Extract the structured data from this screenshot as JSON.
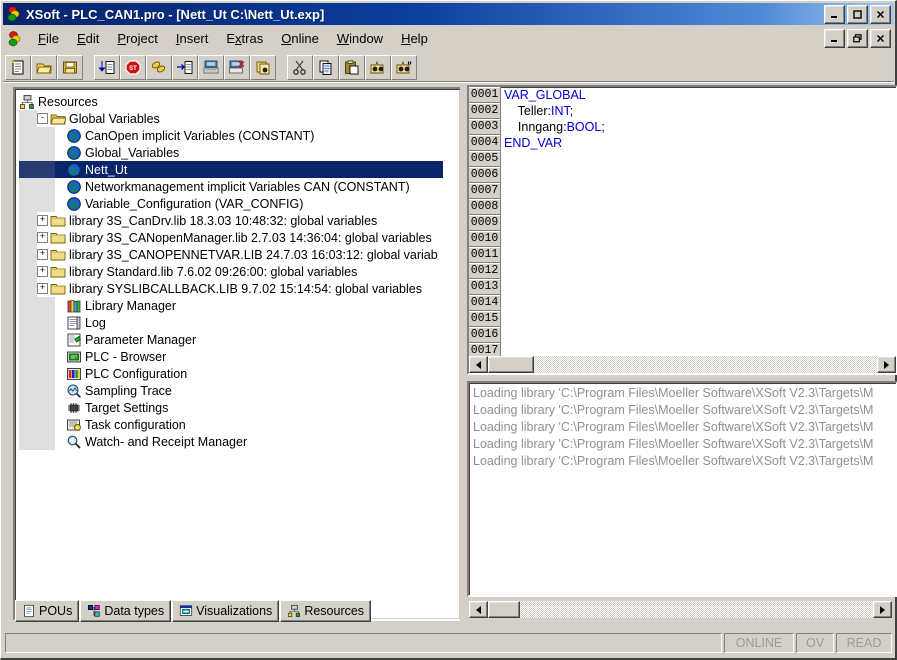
{
  "window": {
    "title": "XSoft - PLC_CAN1.pro - [Nett_Ut C:\\Nett_Ut.exp]",
    "app_icon": "traffic-light-icon",
    "minimize": "_",
    "maximize": "☐",
    "close": "✕",
    "mdi_minimize": "_",
    "mdi_restore": "❐",
    "mdi_close": "✕"
  },
  "menu": {
    "items": [
      {
        "label": "File",
        "accel": "F"
      },
      {
        "label": "Edit",
        "accel": "E"
      },
      {
        "label": "Project",
        "accel": "P"
      },
      {
        "label": "Insert",
        "accel": "I"
      },
      {
        "label": "Extras",
        "accel": "x"
      },
      {
        "label": "Online",
        "accel": "O"
      },
      {
        "label": "Window",
        "accel": "W"
      },
      {
        "label": "Help",
        "accel": "H"
      }
    ]
  },
  "toolbar": {
    "groups": [
      [
        "new-file-icon",
        "open-folder-icon",
        "save-disk-icon"
      ],
      [
        "login-icon",
        "stop-icon",
        "debug-icon",
        "logout-icon",
        "single-cycle-icon",
        "reset-icon",
        "breakpoint-icon"
      ],
      [
        "cut-icon",
        "copy-icon",
        "paste-icon",
        "find-icon",
        "find-next-icon"
      ]
    ]
  },
  "tree": {
    "nodes": [
      {
        "label": "Resources",
        "icon": "resources-icon",
        "indent": 0,
        "expander": "",
        "selected": false
      },
      {
        "label": "Global Variables",
        "icon": "folder-open-icon",
        "indent": 1,
        "expander": "-",
        "selected": false
      },
      {
        "label": "CanOpen implicit Variables (CONSTANT)",
        "icon": "globe-icon",
        "indent": 2,
        "expander": "",
        "selected": false
      },
      {
        "label": "Global_Variables",
        "icon": "globe-icon",
        "indent": 2,
        "expander": "",
        "selected": false
      },
      {
        "label": "Nett_Ut",
        "icon": "globe-icon",
        "indent": 2,
        "expander": "",
        "selected": true
      },
      {
        "label": "Networkmanagement implicit Variables CAN (CONSTANT)",
        "icon": "globe-icon",
        "indent": 2,
        "expander": "",
        "selected": false
      },
      {
        "label": "Variable_Configuration (VAR_CONFIG)",
        "icon": "globe-icon",
        "indent": 2,
        "expander": "",
        "selected": false
      },
      {
        "label": "library 3S_CanDrv.lib 18.3.03 10:48:32: global variables",
        "icon": "folder-icon",
        "indent": 1,
        "expander": "+",
        "selected": false
      },
      {
        "label": "library 3S_CANopenManager.lib 2.7.03 14:36:04: global variables",
        "icon": "folder-icon",
        "indent": 1,
        "expander": "+",
        "selected": false
      },
      {
        "label": "library 3S_CANOPENNETVAR.LIB 24.7.03 16:03:12: global variab",
        "icon": "folder-icon",
        "indent": 1,
        "expander": "+",
        "selected": false
      },
      {
        "label": "library Standard.lib 7.6.02 09:26:00: global variables",
        "icon": "folder-icon",
        "indent": 1,
        "expander": "+",
        "selected": false
      },
      {
        "label": "library SYSLIBCALLBACK.LIB 9.7.02 15:14:54: global variables",
        "icon": "folder-icon",
        "indent": 1,
        "expander": "+",
        "selected": false
      },
      {
        "label": "Library Manager",
        "icon": "library-manager-icon",
        "indent": 2,
        "expander": "",
        "selected": false
      },
      {
        "label": "Log",
        "icon": "log-icon",
        "indent": 2,
        "expander": "",
        "selected": false
      },
      {
        "label": "Parameter Manager",
        "icon": "parameter-manager-icon",
        "indent": 2,
        "expander": "",
        "selected": false
      },
      {
        "label": "PLC - Browser",
        "icon": "plc-browser-icon",
        "indent": 2,
        "expander": "",
        "selected": false
      },
      {
        "label": "PLC Configuration",
        "icon": "plc-configuration-icon",
        "indent": 2,
        "expander": "",
        "selected": false
      },
      {
        "label": "Sampling Trace",
        "icon": "sampling-trace-icon",
        "indent": 2,
        "expander": "",
        "selected": false
      },
      {
        "label": "Target Settings",
        "icon": "target-settings-icon",
        "indent": 2,
        "expander": "",
        "selected": false
      },
      {
        "label": "Task configuration",
        "icon": "task-configuration-icon",
        "indent": 2,
        "expander": "",
        "selected": false
      },
      {
        "label": "Watch- and Receipt Manager",
        "icon": "watch-receipt-manager-icon",
        "indent": 2,
        "expander": "",
        "selected": false
      }
    ]
  },
  "tabs": [
    {
      "label": "POUs",
      "icon": "pous-icon"
    },
    {
      "label": "Data types",
      "icon": "data-types-icon"
    },
    {
      "label": "Visualizations",
      "icon": "visualizations-icon"
    },
    {
      "label": "Resources",
      "icon": "resources-icon"
    }
  ],
  "editor": {
    "lines": [
      {
        "no": "0001",
        "text": "VAR_GLOBAL",
        "segments": [
          {
            "t": "VAR_GLOBAL",
            "c": "kw"
          }
        ]
      },
      {
        "no": "0002",
        "text": "    Teller:INT;",
        "segments": [
          {
            "t": "    ",
            "c": "id"
          },
          {
            "t": "Teller:",
            "c": "id"
          },
          {
            "t": "INT",
            "c": "kw"
          },
          {
            "t": ";",
            "c": "id"
          }
        ]
      },
      {
        "no": "0003",
        "text": "    Inngang:BOOL;",
        "segments": [
          {
            "t": "    ",
            "c": "id"
          },
          {
            "t": "Inngang:",
            "c": "id"
          },
          {
            "t": "BOOL",
            "c": "kw"
          },
          {
            "t": ";",
            "c": "id"
          }
        ]
      },
      {
        "no": "0004",
        "text": "END_VAR",
        "segments": [
          {
            "t": "END_VAR",
            "c": "kw"
          }
        ]
      },
      {
        "no": "0005",
        "text": "",
        "segments": []
      },
      {
        "no": "0006",
        "text": "",
        "segments": []
      },
      {
        "no": "0007",
        "text": "",
        "segments": []
      },
      {
        "no": "0008",
        "text": "",
        "segments": []
      },
      {
        "no": "0009",
        "text": "",
        "segments": []
      },
      {
        "no": "0010",
        "text": "",
        "segments": []
      },
      {
        "no": "0011",
        "text": "",
        "segments": []
      },
      {
        "no": "0012",
        "text": "",
        "segments": []
      },
      {
        "no": "0013",
        "text": "",
        "segments": []
      },
      {
        "no": "0014",
        "text": "",
        "segments": []
      },
      {
        "no": "0015",
        "text": "",
        "segments": []
      },
      {
        "no": "0016",
        "text": "",
        "segments": []
      },
      {
        "no": "0017",
        "text": "",
        "segments": []
      }
    ]
  },
  "messages": {
    "lines": [
      "Loading library 'C:\\Program Files\\Moeller Software\\XSoft V2.3\\Targets\\M",
      "Loading library 'C:\\Program Files\\Moeller Software\\XSoft V2.3\\Targets\\M",
      "Loading library 'C:\\Program Files\\Moeller Software\\XSoft V2.3\\Targets\\M",
      "Loading library 'C:\\Program Files\\Moeller Software\\XSoft V2.3\\Targets\\M",
      "Loading library 'C:\\Program Files\\Moeller Software\\XSoft V2.3\\Targets\\M"
    ]
  },
  "statusbar": {
    "main": "",
    "online": "ONLINE",
    "ov": "OV",
    "read": "READ"
  },
  "colors": {
    "title_start": "#08246b",
    "title_end": "#a6c8ef",
    "selection": "#0a246a",
    "face": "#d4d0c8",
    "keyword": "#0000cd",
    "log_text": "#909090"
  }
}
